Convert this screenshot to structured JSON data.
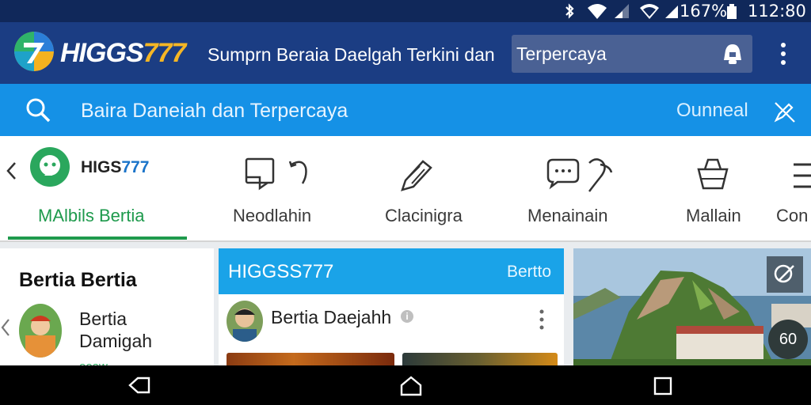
{
  "status_bar": {
    "battery": "167%",
    "time": "112:80",
    "icons": [
      "bluetooth-icon",
      "wifi-icon",
      "signal-icon",
      "wifi-icon",
      "signal-icon",
      "battery-icon"
    ]
  },
  "header": {
    "brand_text": "HIGGS",
    "brand_number": "777",
    "tagline": "Sumprn Beraia Daelgah Terkini dan",
    "search_value": "Terpercaya",
    "search_icon": "bell-icon",
    "menu_icon": "more-vert-icon"
  },
  "search_bar": {
    "text": "Baira Daneiah dan Terpercaya",
    "right_link": "Ounneal",
    "right_icon": "edit-off-icon",
    "left_icon": "search-icon"
  },
  "tabs": {
    "brand_text": "HIGS",
    "brand_number": "777",
    "items": [
      {
        "label": "MAlbils Bertia",
        "icon": "brand-logo-icon",
        "active": true
      },
      {
        "label": "Neodlahin",
        "icon": "folder-redo-icon",
        "active": false
      },
      {
        "label": "Clacinigra",
        "icon": "pen-icon",
        "active": false
      },
      {
        "label": "Menainain",
        "icon": "chat-icon",
        "active": false
      },
      {
        "label": "Mallain",
        "icon": "basket-icon",
        "active": false
      },
      {
        "label": "Con",
        "icon": "menu-icon",
        "active": false
      }
    ]
  },
  "left_panel": {
    "title": "Bertia Bertia",
    "name_line1": "Bertia",
    "name_line2": "Damigah",
    "green_text": "ooaw"
  },
  "center_card": {
    "title": "HIGGSS777",
    "right_label": "Bertto",
    "author": "Bertia Daejahh",
    "info_icon": "info-icon",
    "more_icon": "more-vert-icon"
  },
  "right_image": {
    "badge": "60",
    "close_icon": "close-icon"
  },
  "nav_bar": {
    "icons": [
      "back-icon",
      "home-icon",
      "recents-icon"
    ]
  },
  "colors": {
    "status_bar": "#10285a",
    "header": "#1b3d83",
    "search_bar": "#1591e6",
    "accent_green": "#1e9a4c",
    "brand_gold": "#f5b625",
    "card_header": "#1aa3e8"
  }
}
